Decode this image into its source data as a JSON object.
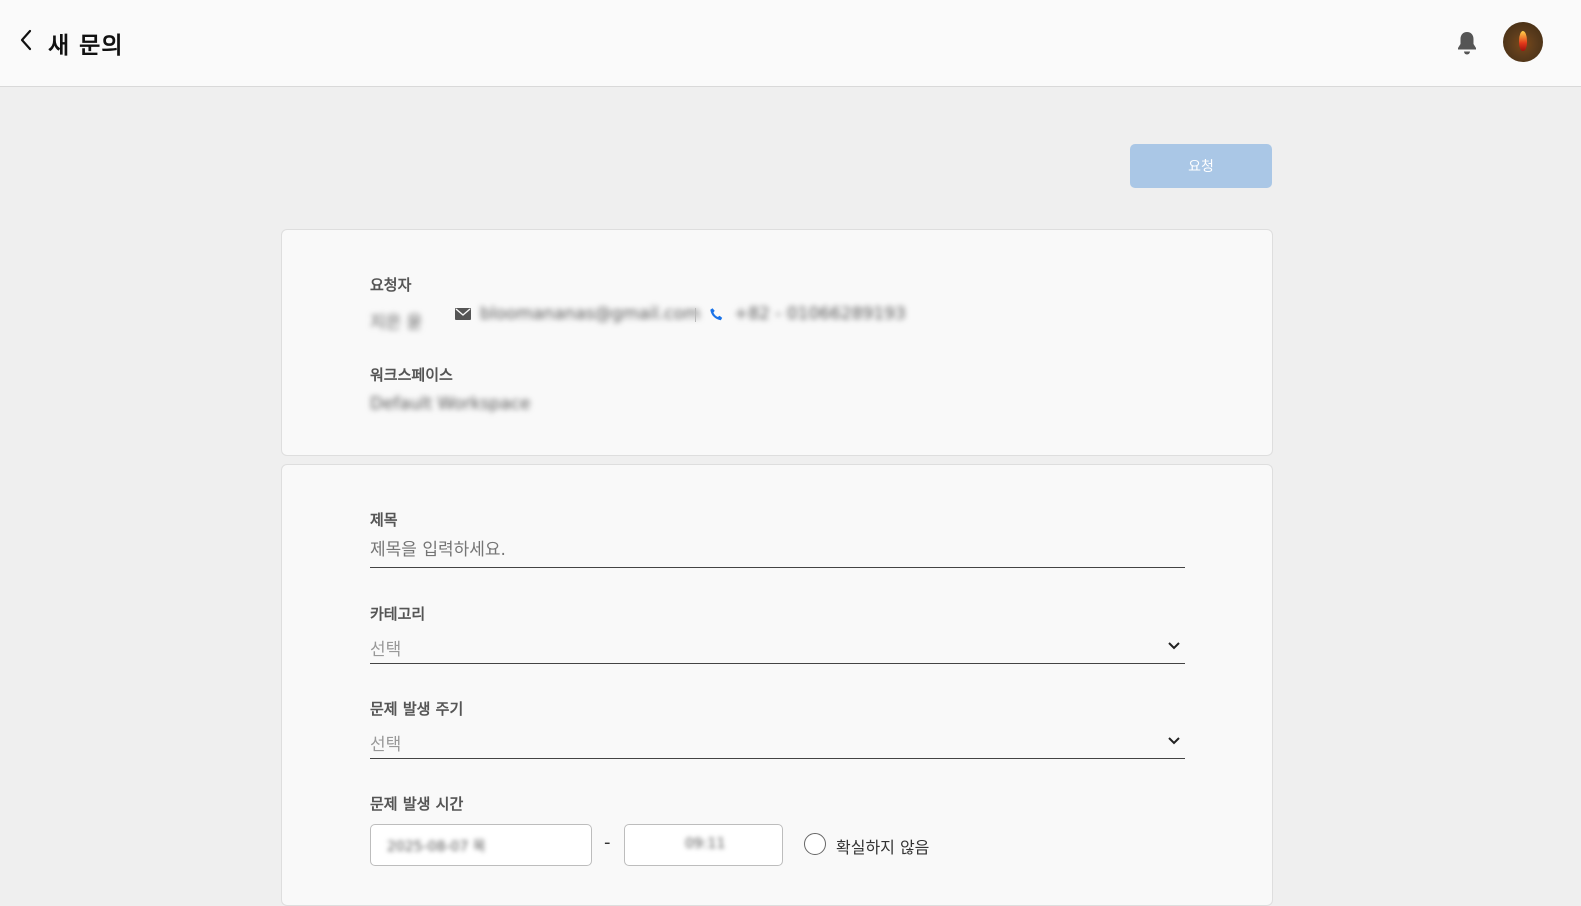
{
  "header": {
    "title": "새 문의",
    "back_icon": "chevron-left-icon",
    "notification_icon": "bell-icon"
  },
  "actions": {
    "submit_label": "요청"
  },
  "requester": {
    "label": "요청자",
    "name": "지은 윤",
    "email": "bloomananas@gmail.com",
    "phone": "+82 - 01066289193"
  },
  "workspace": {
    "label": "워크스페이스",
    "value": "Default Workspace"
  },
  "form": {
    "title_label": "제목",
    "title_placeholder": "제목을 입력하세요.",
    "category_label": "카테고리",
    "category_value": "선택",
    "frequency_label": "문제 발생 주기",
    "frequency_value": "선택",
    "time_label": "문제 발생 시간",
    "date_value": "2025-08-07 목",
    "time_value": "09:11",
    "range_separator": "-",
    "unsure_label": "확실하지 않음"
  },
  "colors": {
    "submit_button": "#aac7e6",
    "phone_icon": "#1a73e8",
    "page_background": "#efefef"
  }
}
